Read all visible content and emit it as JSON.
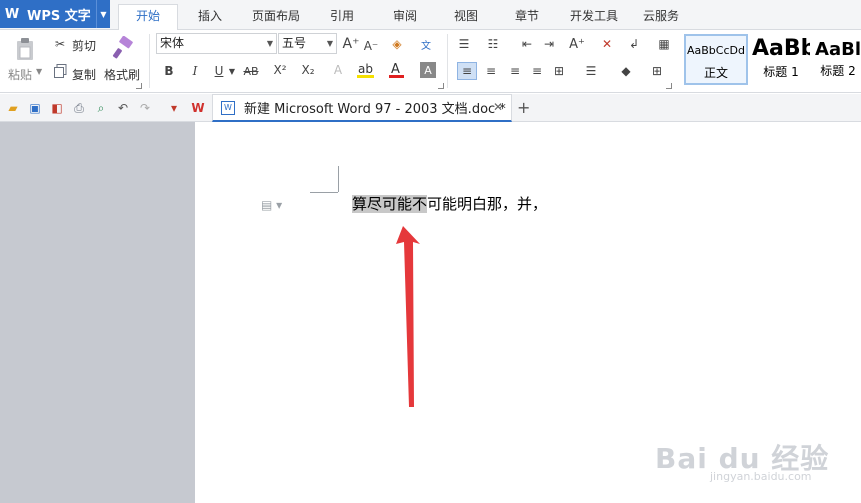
{
  "app": {
    "title": "WPS 文字"
  },
  "menu_tabs": [
    "开始",
    "插入",
    "页面布局",
    "引用",
    "审阅",
    "视图",
    "章节",
    "开发工具",
    "云服务"
  ],
  "ribbon": {
    "paste_label": "粘贴",
    "cut_label": "剪切",
    "copy_label": "复制",
    "format_painter_label": "格式刷",
    "font_name": "宋体",
    "font_size": "五号",
    "styles": [
      {
        "sample": "AaBbCcDd",
        "name": "正文"
      },
      {
        "sample": "AaBb",
        "name": "标题 1"
      },
      {
        "sample": "AaBl",
        "name": "标题 2"
      }
    ],
    "accent_color": "#2f6fc6"
  },
  "doc_tab": {
    "title": "新建 Microsoft Word 97 - 2003 文档.doc *"
  },
  "document": {
    "selected_text": "算尽可能不",
    "rest_text": "可能明白那，并，"
  },
  "watermark": {
    "text": "Bai du 经验",
    "sub": "jingyan.baidu.com"
  }
}
